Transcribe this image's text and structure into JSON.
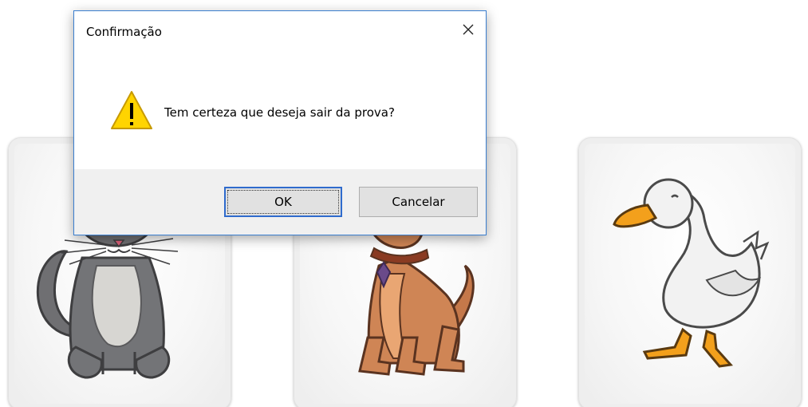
{
  "dialog": {
    "title": "Confirmação",
    "message": "Tem certeza que deseja sair da prova?",
    "icon": "warning-icon",
    "ok_label": "OK",
    "cancel_label": "Cancelar",
    "close_icon": "close-icon",
    "accent_color": "#3a7ecf",
    "warning_color": "#ffd400"
  },
  "cards": [
    {
      "icon": "cat-illustration"
    },
    {
      "icon": "dog-illustration"
    },
    {
      "icon": "duck-illustration"
    }
  ]
}
